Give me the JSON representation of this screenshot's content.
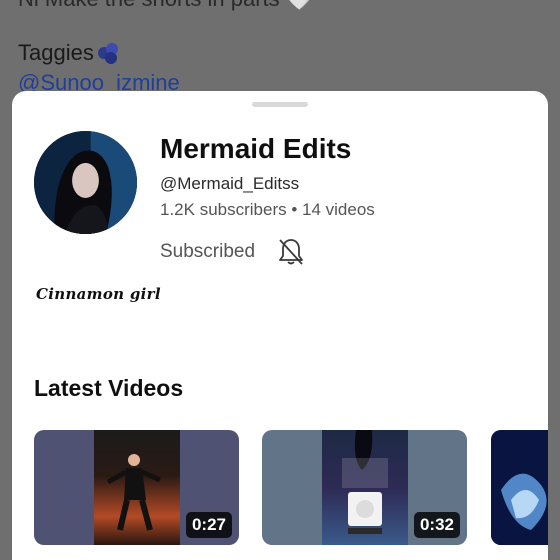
{
  "background": {
    "description_line": "Ni Make the shorts in parts 🤍",
    "tag_label": "Taggies",
    "tag_emoji": "blueberries-icon",
    "mention": "@Sunoo_izmine"
  },
  "channel": {
    "name": "Mermaid Edits",
    "handle": "@Mermaid_Editss",
    "stats": "1.2K subscribers • 14 videos",
    "subscribe_status": "Subscribed",
    "notification_icon": "bell-off-icon",
    "tagline": "Cinnamon girl"
  },
  "latest": {
    "title": "Latest Videos",
    "videos": [
      {
        "duration": "0:27"
      },
      {
        "duration": "0:32"
      }
    ]
  },
  "colors": {
    "accent_link": "#1f3f99",
    "sheet_bg": "#ffffff",
    "overlay": "#6f6f6f"
  }
}
